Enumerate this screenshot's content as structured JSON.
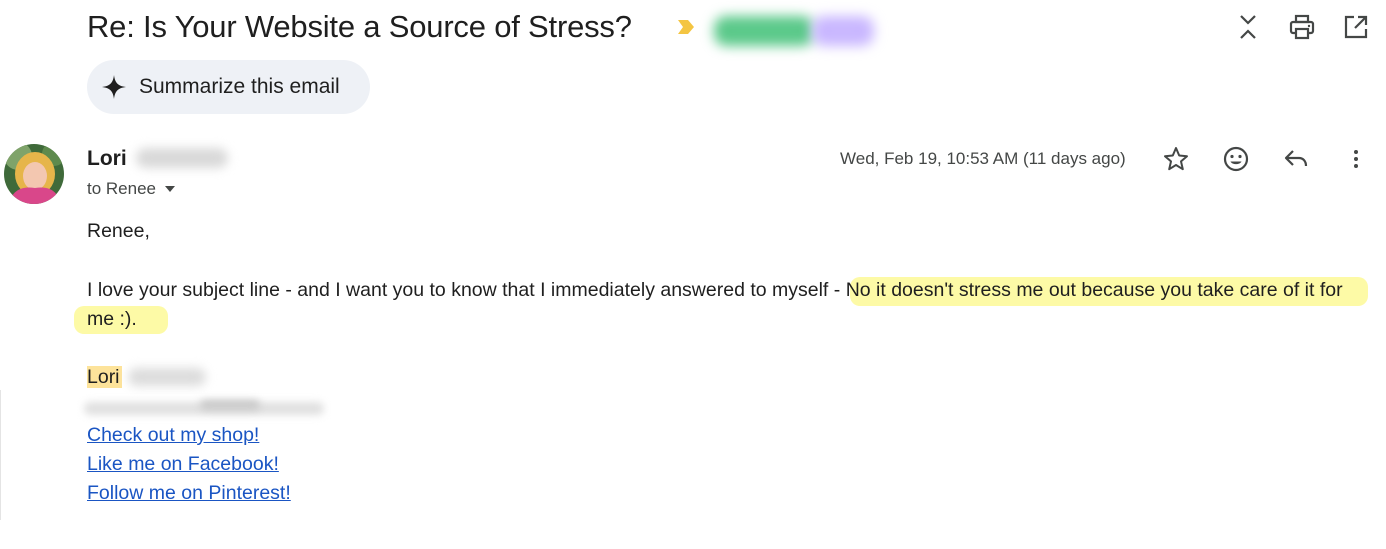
{
  "thread": {
    "subject": "Re: Is Your Website a Source of Stress?",
    "importance_color": "#f4c542",
    "label_colors": [
      "#5bc98a",
      "#c9b7ff"
    ]
  },
  "actions": {
    "summarize_label": "Summarize this email",
    "top_icons": [
      "collapse-all-icon",
      "print-icon",
      "open-in-new-window-icon"
    ],
    "message_icons": [
      "star-icon",
      "emoji-icon",
      "reply-icon",
      "more-vert-icon"
    ]
  },
  "message": {
    "sender_first_name": "Lori",
    "recipient_text": "to Renee",
    "timestamp": "Wed, Feb 19, 10:53 AM (11 days ago)",
    "greeting": "Renee,",
    "body_line1_plain": "I love your subject line - and I want you to know that I immediately answered to myself ",
    "body_line1_highlight": "- No it doesn't stress me out because you take care of it for",
    "body_line2_highlight": "me :).",
    "signature_name": "Lori",
    "links": [
      "Check out my shop!",
      "Like me on Facebook!",
      "Follow me on Pinterest!"
    ],
    "colors": {
      "link": "#1a55c3",
      "highlight": "#fdfaa6",
      "signature_highlight": "#fde39a",
      "summarize_bg": "#eef1f6"
    }
  }
}
